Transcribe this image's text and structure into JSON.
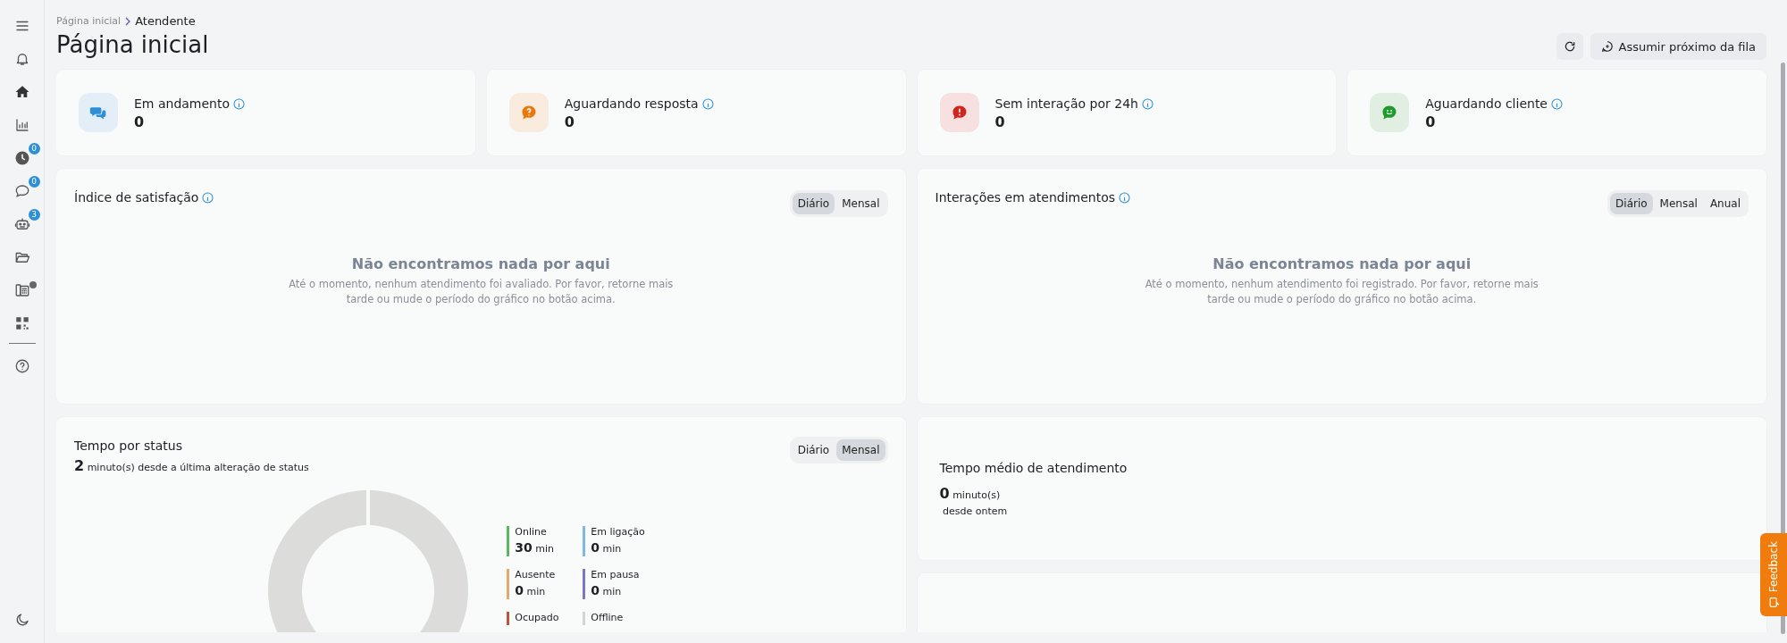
{
  "sidebar": {
    "items": [
      {
        "kind": "menu",
        "selected": false,
        "dot": false
      },
      {
        "kind": "bell",
        "selected": false,
        "dot": false
      },
      {
        "kind": "home",
        "selected": true,
        "dot": false
      },
      {
        "kind": "chart",
        "selected": false,
        "dot": false
      },
      {
        "kind": "clock",
        "selected": false,
        "badge": "0",
        "dot": false
      },
      {
        "kind": "chat",
        "selected": false,
        "badge": "0",
        "dot": false
      },
      {
        "kind": "robot",
        "selected": false,
        "badge": "3",
        "dot": false
      },
      {
        "kind": "folder",
        "selected": false,
        "dot": false
      },
      {
        "kind": "phone",
        "selected": false,
        "dot": true
      },
      {
        "kind": "grid",
        "selected": false,
        "dot": false
      },
      {
        "kind": "help",
        "selected": false,
        "dot": false
      }
    ],
    "bottom": {
      "kind": "moon"
    }
  },
  "breadcrumb": [
    "Página inicial",
    "Atendente"
  ],
  "title": "Página inicial",
  "actions": {
    "next_label": "Assumir próximo da fila"
  },
  "kpis": [
    {
      "kind": "chat",
      "label": "Em andamento",
      "value": "0",
      "color": "#2f8fd6"
    },
    {
      "kind": "question",
      "label": "Aguardando resposta",
      "value": "0",
      "color": "#e8790c"
    },
    {
      "kind": "alert",
      "label": "Sem interação por 24h",
      "value": "0",
      "color": "#d2261c"
    },
    {
      "kind": "smile",
      "label": "Aguardando cliente",
      "value": "0",
      "color": "#1f9a2c"
    }
  ],
  "charts": [
    {
      "title": "Índice de satisfação",
      "periods": [
        {
          "label": "Diário",
          "selected": true
        },
        {
          "label": "Mensal",
          "selected": false
        }
      ],
      "empty_title": "Não encontramos nada por aqui",
      "empty_text": "Até o momento, nenhum atendimento foi avaliado. Por favor, retorne mais tarde ou mude o período do gráfico no botão acima."
    },
    {
      "title": "Interações em atendimentos",
      "periods": [
        {
          "label": "Diário",
          "selected": true
        },
        {
          "label": "Mensal",
          "selected": false
        },
        {
          "label": "Anual",
          "selected": false
        }
      ],
      "empty_title": "Não encontramos nada por aqui",
      "empty_text": "Até o momento, nenhum atendimento foi registrado. Por favor, retorne mais tarde ou mude o período do gráfico no botão acima."
    }
  ],
  "status_time": {
    "title": "Tempo por status",
    "summary": "**2** minuto(s) desde a última alteração de status",
    "periods": [
      {
        "label": "Diário",
        "selected": false
      },
      {
        "label": "Mensal",
        "selected": true
      }
    ],
    "legend": [
      {
        "label": "Online",
        "value": "**30** min",
        "color": "#5cb85c"
      },
      {
        "label": "Em ligação",
        "value": "**0** min",
        "color": "#7db9e3"
      },
      {
        "label": "Ausente",
        "value": "**0** min",
        "color": "#e8a867"
      },
      {
        "label": "Em pausa",
        "value": "**0** min",
        "color": "#7a78c6"
      },
      {
        "label": "Ocupado",
        "color": "#c0533b"
      },
      {
        "label": "Offline",
        "color": "#d4d4d4"
      }
    ]
  },
  "avg_time": {
    "title": "Tempo médio de atendimento",
    "value": "**0** minuto(s)",
    "note": " desde ontem"
  },
  "feedback": "Feedback"
}
